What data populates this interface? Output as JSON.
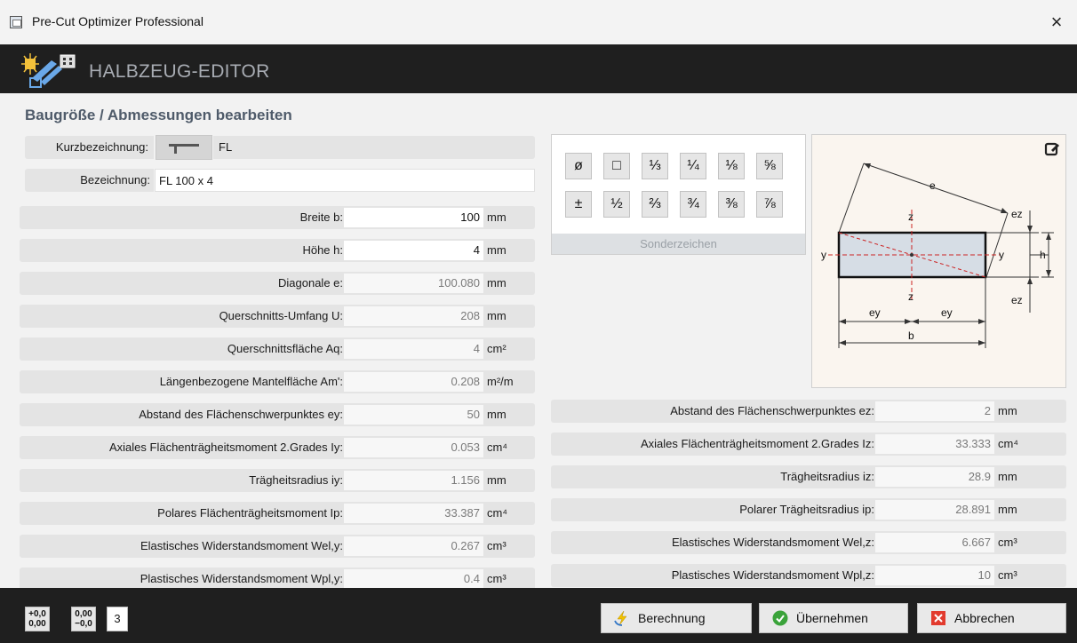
{
  "window": {
    "title": "Pre-Cut Optimizer Professional",
    "close_glyph": "×"
  },
  "header": {
    "title": "HALBZEUG-EDITOR"
  },
  "section": {
    "title": "Baugröße / Abmessungen bearbeiten"
  },
  "short_name": {
    "label": "Kurzbezeichnung:",
    "value": "FL"
  },
  "designation": {
    "label": "Bezeichnung:",
    "value": "FL 100 x 4"
  },
  "left_rows": [
    {
      "label": "Breite b:",
      "value": "100",
      "unit": "mm",
      "editable": true
    },
    {
      "label": "Höhe h:",
      "value": "4",
      "unit": "mm",
      "editable": true
    },
    {
      "label": "Diagonale e:",
      "value": "100.080",
      "unit": "mm",
      "editable": false
    },
    {
      "label": "Querschnitts-Umfang U:",
      "value": "208",
      "unit": "mm",
      "editable": false
    },
    {
      "label": "Querschnittsfläche Aq:",
      "value": "4",
      "unit": "cm²",
      "editable": false
    },
    {
      "label": "Längenbezogene Mantelfläche Am':",
      "value": "0.208",
      "unit": "m²/m",
      "editable": false
    },
    {
      "label": "Abstand des Flächenschwerpunktes ey:",
      "value": "50",
      "unit": "mm",
      "editable": false
    },
    {
      "label": "Axiales Flächenträgheitsmoment 2.Grades Iy:",
      "value": "0.053",
      "unit": "cm⁴",
      "editable": false
    },
    {
      "label": "Trägheitsradius iy:",
      "value": "1.156",
      "unit": "mm",
      "editable": false
    },
    {
      "label": "Polares Flächenträgheitsmoment Ip:",
      "value": "33.387",
      "unit": "cm⁴",
      "editable": false
    },
    {
      "label": "Elastisches Widerstandsmoment Wel,y:",
      "value": "0.267",
      "unit": "cm³",
      "editable": false
    },
    {
      "label": "Plastisches Widerstandsmoment Wpl,y:",
      "value": "0.4",
      "unit": "cm³",
      "editable": false
    }
  ],
  "right_rows": [
    {
      "label": "Abstand des Flächenschwerpunktes ez:",
      "value": "2",
      "unit": "mm"
    },
    {
      "label": "Axiales Flächenträgheitsmoment 2.Grades Iz:",
      "value": "33.333",
      "unit": "cm⁴"
    },
    {
      "label": "Trägheitsradius iz:",
      "value": "28.9",
      "unit": "mm"
    },
    {
      "label": "Polarer Trägheitsradius ip:",
      "value": "28.891",
      "unit": "mm"
    },
    {
      "label": "Elastisches Widerstandsmoment Wel,z:",
      "value": "6.667",
      "unit": "cm³"
    },
    {
      "label": "Plastisches Widerstandsmoment Wpl,z:",
      "value": "10",
      "unit": "cm³"
    }
  ],
  "special_chars": {
    "label": "Sonderzeichen",
    "row1": [
      "ø",
      "□",
      "⅓",
      "¼",
      "⅛",
      "⅝"
    ],
    "row2": [
      "±",
      "½",
      "⅔",
      "¾",
      "⅜",
      "⅞"
    ]
  },
  "diagram": {
    "labels": {
      "e": "e",
      "z_top": "z",
      "z_bottom": "z",
      "ez_top": "ez",
      "ez_bottom": "ez",
      "y_left": "y",
      "y_right": "y",
      "h": "h",
      "ey_left": "ey",
      "ey_right": "ey",
      "b": "b"
    }
  },
  "footer": {
    "dec_plus_top": "+0,0",
    "dec_plus_bottom": "0,00",
    "dec_minus_top": "0,00",
    "dec_minus_bottom": "−0,0",
    "decimals": "3",
    "calc_label": "Berechnung",
    "apply_label": "Übernehmen",
    "cancel_label": "Abbrechen"
  },
  "colors": {
    "header_bg": "#1f1f1f",
    "row_bg": "#e4e4e4",
    "bolt": "#f2c200",
    "ok_green": "#3aa33a",
    "cancel_red": "#e23b2e"
  }
}
